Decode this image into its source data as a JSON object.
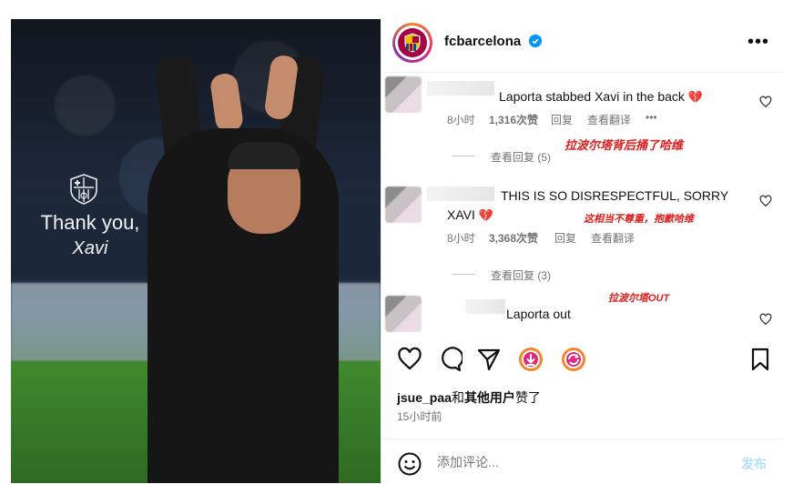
{
  "post": {
    "image_overlay": {
      "line1": "Thank you,",
      "line2": "Xavi"
    }
  },
  "header": {
    "username": "fcbarcelona",
    "more_icon": "more-horizontal-icon"
  },
  "comments": [
    {
      "text": "Laporta stabbed Xavi in the back",
      "emoji": "💔",
      "time": "8小时",
      "likes": "1,316次赞",
      "reply": "回复",
      "translate": "查看翻译",
      "more": "•••",
      "annotation": "拉波尔塔背后捅了哈维",
      "view_replies": "查看回复 (5)"
    },
    {
      "text_line1": "THIS IS SO DISRESPECTFUL, SORRY",
      "text_line2": "XAVI",
      "emoji": "💔",
      "time": "8小时",
      "likes": "3,368次赞",
      "reply": "回复",
      "translate": "查看翻译",
      "annotation": "这相当不尊重，抱歉哈维",
      "view_replies": "查看回复 (3)"
    },
    {
      "text": "Laporta out",
      "annotation": "拉波尔塔OUT"
    }
  ],
  "actions": {
    "icons": [
      "heart-icon",
      "comment-icon",
      "share-icon",
      "download-icon",
      "repost-icon",
      "bookmark-icon"
    ]
  },
  "likes": {
    "user": "jsue_paa",
    "joiner": "和",
    "others": "其他用户",
    "suffix": "赞了"
  },
  "time_ago": "15小时前",
  "comment_box": {
    "placeholder": "添加评论...",
    "post_label": "发布"
  },
  "colors": {
    "accent": "#0095f6",
    "annotation": "#e21b1b",
    "heart": "#e0245e"
  }
}
